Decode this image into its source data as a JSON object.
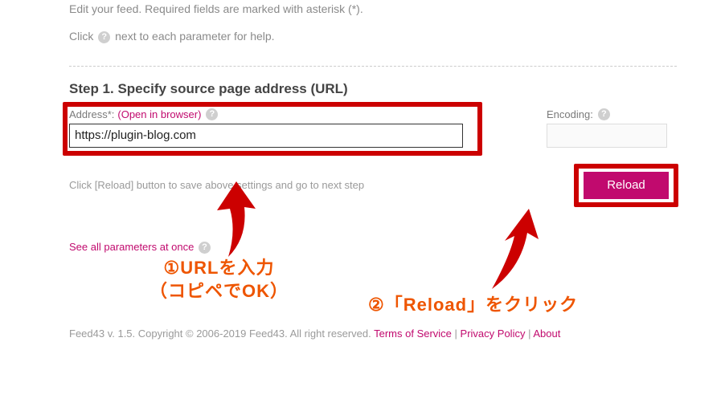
{
  "intro": {
    "line1": "Edit your feed. Required fields are marked with asterisk (*).",
    "line2_a": "Click",
    "line2_b": "next to each parameter for help."
  },
  "step1": {
    "title": "Step 1. Specify source page address (URL)",
    "address_label": "Address*:",
    "open_in_browser": "(Open in browser)",
    "address_value": "https://plugin-blog.com",
    "encoding_label": "Encoding:",
    "encoding_value": "",
    "hint": "Click [Reload] button to save above settings and go to next step",
    "reload_label": "Reload"
  },
  "see_all_label": "See all parameters at once",
  "footer": {
    "prefix": "Feed43 v. 1.5. Copyright © ",
    "middle1": "2006-2019 Feed43. All right reserved. ",
    "tos": "Terms of Service",
    "sep": " | ",
    "privacy": "Privacy Policy",
    "sep2": " | ",
    "about": "About"
  },
  "annotations": {
    "a1_line1": "①URLを入力",
    "a1_line2": "（コピペでOK）",
    "a2": "②「Reload」をクリック"
  }
}
